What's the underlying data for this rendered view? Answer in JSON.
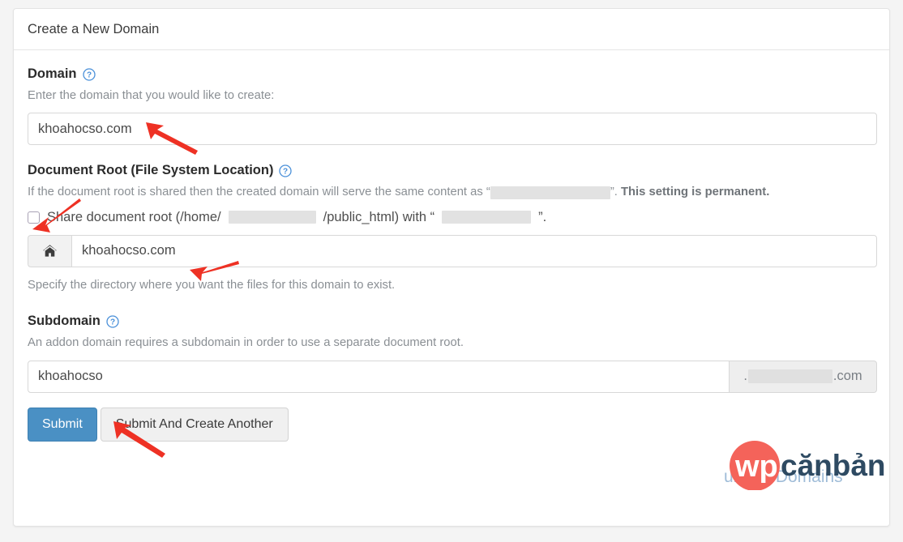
{
  "card": {
    "title": "Create a New Domain"
  },
  "domain_section": {
    "label": "Domain",
    "help_icon": "help-circle-icon",
    "description": "Enter the domain that you would like to create:",
    "input_value": "khoahocso.com",
    "input_placeholder": ""
  },
  "document_root_section": {
    "label": "Document Root (File System Location)",
    "help_icon": "help-circle-icon",
    "description_before": "If the document root is shared then the created domain will serve the same content as “",
    "description_after": "”.",
    "permanent_note": "This setting is permanent.",
    "checkbox": {
      "checked": false,
      "text_before": "Share document root (/home/",
      "text_middle": "/public_html) with “",
      "text_after": "”."
    },
    "home_icon": "home-icon",
    "input_value": "khoahocso.com",
    "input_placeholder": "",
    "footer_help": "Specify the directory where you want the files for this domain to exist."
  },
  "subdomain_section": {
    "label": "Subdomain",
    "help_icon": "help-circle-icon",
    "description": "An addon domain requires a subdomain in order to use a separate document root.",
    "input_value": "khoahocso",
    "input_placeholder": "",
    "suffix_prefix": ".",
    "suffix_tld": ".com"
  },
  "buttons": {
    "submit": "Submit",
    "submit_and_create_another": "Submit And Create Another"
  },
  "return_link": {
    "text": "urn To Domains"
  },
  "watermark": {
    "wp": "wp",
    "canban": "cănbản"
  },
  "colors": {
    "primary": "#4a90c4",
    "link": "#337ab7",
    "annotation_arrow": "#ee3124",
    "watermark_circle": "#f4635a",
    "watermark_text": "#2e4a62",
    "page_background": "#f4f4f4",
    "card_background": "#ffffff",
    "redaction": "#e2e2e2"
  },
  "annotations": {
    "arrow_domain_input": "red-arrow-icon",
    "arrow_share_checkbox": "red-arrow-icon",
    "arrow_document_root_input": "red-arrow-icon",
    "arrow_subdomain_input": "red-arrow-icon"
  }
}
